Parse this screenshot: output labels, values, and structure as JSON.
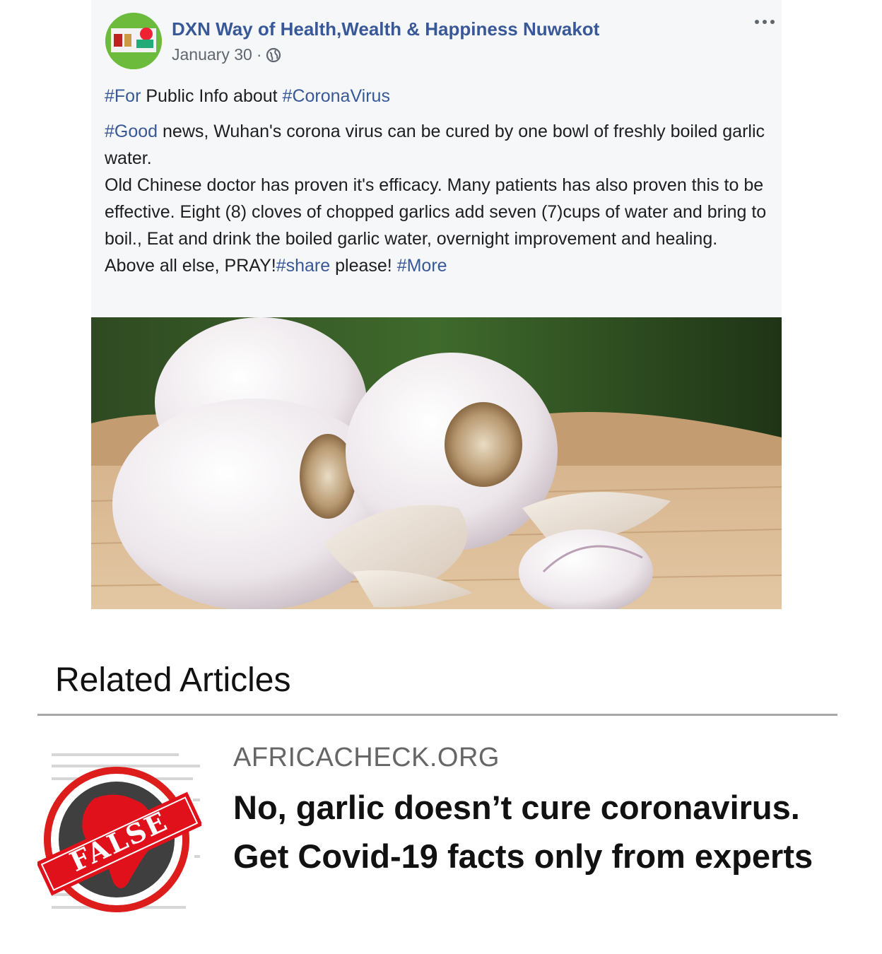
{
  "post": {
    "page_name": "DXN Way of Health,Wealth & Happiness Nuwakot",
    "date": "January 30",
    "separator": "·",
    "line1": {
      "tag1": "#For",
      "text1": " Public Info about ",
      "tag2": "#CoronaVirus"
    },
    "para": {
      "tag": "#Good",
      "text": " news, Wuhan's corona virus can be cured by one bowl of freshly boiled garlic water."
    },
    "para2": "Old Chinese doctor has proven it's efficacy. Many patients has also proven this to be effective. Eight (8) cloves of chopped garlics add seven (7)cups of water and bring to boil., Eat and drink the boiled garlic water, overnight improvement and healing.",
    "para3": {
      "text1": "Above all else, PRAY!",
      "tag1": "#share",
      "text2": " please! ",
      "tag2": "#More"
    },
    "avatar_label": "DXN",
    "icons": {
      "privacy": "globe-icon",
      "options": "more-options-icon"
    }
  },
  "related": {
    "heading": "Related Articles",
    "source": "AFRICACHECK.ORG",
    "headline": "No, garlic doesn’t cure coronavirus. Get Covid-19 facts only from experts",
    "stamp_text": "FALSE"
  },
  "colors": {
    "link": "#385898",
    "stamp_red": "#e0111b",
    "post_bg": "#f6f7f9"
  }
}
